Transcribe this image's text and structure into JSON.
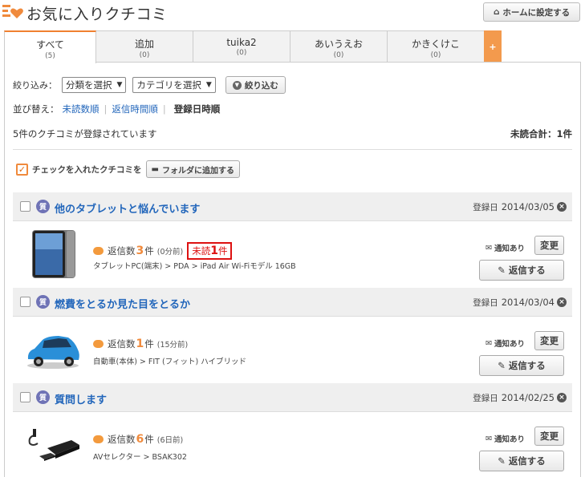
{
  "header": {
    "title": "お気に入りクチコミ",
    "home_button": "ホームに設定する"
  },
  "tabs": [
    {
      "label": "すべて",
      "count": "(5)"
    },
    {
      "label": "追加",
      "count": "(0)"
    },
    {
      "label": "tuika2",
      "count": "(0)"
    },
    {
      "label": "あいうえお",
      "count": "(0)"
    },
    {
      "label": "かきくけこ",
      "count": "(0)"
    }
  ],
  "tab_add_label": "+",
  "filter": {
    "label": "絞り込み：",
    "category_select": "分類を選択",
    "subcategory_select": "カテゴリを選択",
    "button": "絞り込む"
  },
  "sort": {
    "label": "並び替え：",
    "opt1": "未読数順",
    "opt2": "返信時間順",
    "active": "登録日時順"
  },
  "summary": {
    "count_text": "5件のクチコミが登録されています",
    "unread_total": "未読合計：1件"
  },
  "bulk": {
    "label": "チェックを入れたクチコミを",
    "folder_button": "フォルダに追加する"
  },
  "items": [
    {
      "title": "他のタブレットと悩んでいます",
      "date_label": "登録日",
      "date": "2014/03/05",
      "reply_prefix": "返信数",
      "reply_count": "3",
      "reply_suffix": "件",
      "reply_time": "(0分前)",
      "unread_prefix": "未読",
      "unread_count": "1",
      "unread_suffix": "件",
      "category": "タブレットPC(端末) > PDA > iPad Air Wi-Fiモデル 16GB",
      "notice": "通知あり",
      "change": "変更",
      "reply_button": "返信する"
    },
    {
      "title": "燃費をとるか見た目をとるか",
      "date_label": "登録日",
      "date": "2014/03/04",
      "reply_prefix": "返信数",
      "reply_count": "1",
      "reply_suffix": "件",
      "reply_time": "(15分前)",
      "category": "自動車(本体) > FIT (フィット) ハイブリッド",
      "notice": "通知あり",
      "change": "変更",
      "reply_button": "返信する"
    },
    {
      "title": "質問します",
      "date_label": "登録日",
      "date": "2014/02/25",
      "reply_prefix": "返信数",
      "reply_count": "6",
      "reply_suffix": "件",
      "reply_time": "(6日前)",
      "category": "AVセレクター > BSAK302",
      "notice": "通知あり",
      "change": "変更",
      "reply_button": "返信する"
    }
  ],
  "colors": {
    "accent": "#f08a3c",
    "link": "#2266bb",
    "unread": "#dd1111",
    "question_icon": "#6f73b6"
  }
}
